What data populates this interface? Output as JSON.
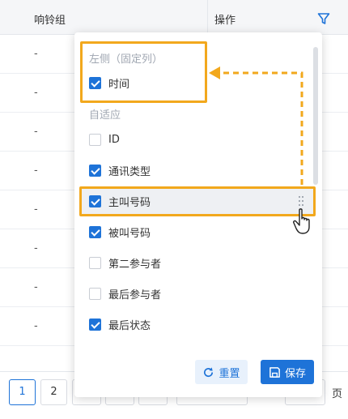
{
  "table": {
    "headers": {
      "ring_group": "响铃组",
      "actions": "操作"
    },
    "cells": [
      "-",
      "-",
      "-",
      "-",
      "-",
      "-",
      "-",
      "-",
      "-"
    ]
  },
  "pagination": {
    "pages": [
      "1",
      "2"
    ],
    "current": "1",
    "unit": "页"
  },
  "column_panel": {
    "fixed_group_title": "左侧（固定列）",
    "fixed_items": [
      {
        "label": "时间",
        "checked": true
      }
    ],
    "adaptive_group_title": "自适应",
    "adaptive_items": [
      {
        "label": "ID",
        "checked": false
      },
      {
        "label": "通讯类型",
        "checked": true
      },
      {
        "label": "主叫号码",
        "checked": true
      },
      {
        "label": "被叫号码",
        "checked": true
      },
      {
        "label": "第二参与者",
        "checked": false
      },
      {
        "label": "最后参与者",
        "checked": false
      },
      {
        "label": "最后状态",
        "checked": true
      }
    ],
    "reset_label": "重置",
    "save_label": "保存"
  },
  "colors": {
    "accent": "#1e73d8",
    "highlight": "#f2a81d"
  }
}
